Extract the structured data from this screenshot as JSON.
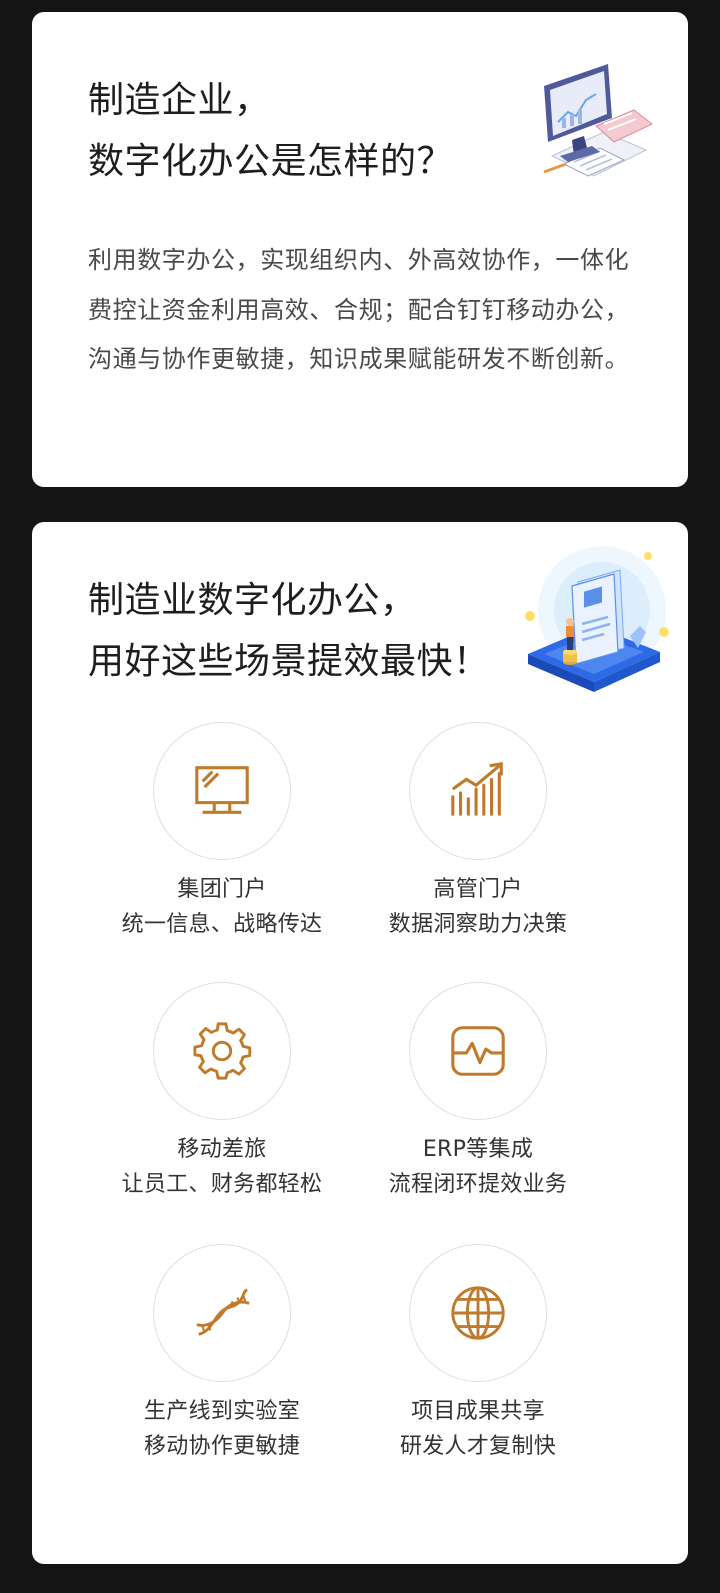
{
  "colors": {
    "accent": "#c07a2c",
    "page_bg": "#141414",
    "card_bg": "#ffffff"
  },
  "section1": {
    "title_line1": "制造企业，",
    "title_line2": "数字化办公是怎样的？",
    "description": "利用数字办公，实现组织内、外高效协作，一体化费控让资金利用高效、合规；配合钉钉移动办公，沟通与协作更敏捷，知识成果赋能研发不断创新。",
    "illustration": "office-monitor-documents-illustration"
  },
  "section2": {
    "title_line1": "制造业数字化办公，",
    "title_line2": "用好这些场景提效最快！",
    "illustration": "person-with-id-card-platform-illustration",
    "features": [
      {
        "icon": "monitor-icon",
        "title": "集团门户",
        "subtitle": "统一信息、战略传达"
      },
      {
        "icon": "growth-chart-icon",
        "title": "高管门户",
        "subtitle": "数据洞察助力决策"
      },
      {
        "icon": "gear-icon",
        "title": "移动差旅",
        "subtitle": "让员工、财务都轻松"
      },
      {
        "icon": "pulse-monitor-icon",
        "title": "ERP等集成",
        "subtitle": "流程闭环提效业务"
      },
      {
        "icon": "dna-icon",
        "title": "生产线到实验室",
        "subtitle": "移动协作更敏捷"
      },
      {
        "icon": "globe-icon",
        "title": "项目成果共享",
        "subtitle": "研发人才复制快"
      }
    ]
  }
}
